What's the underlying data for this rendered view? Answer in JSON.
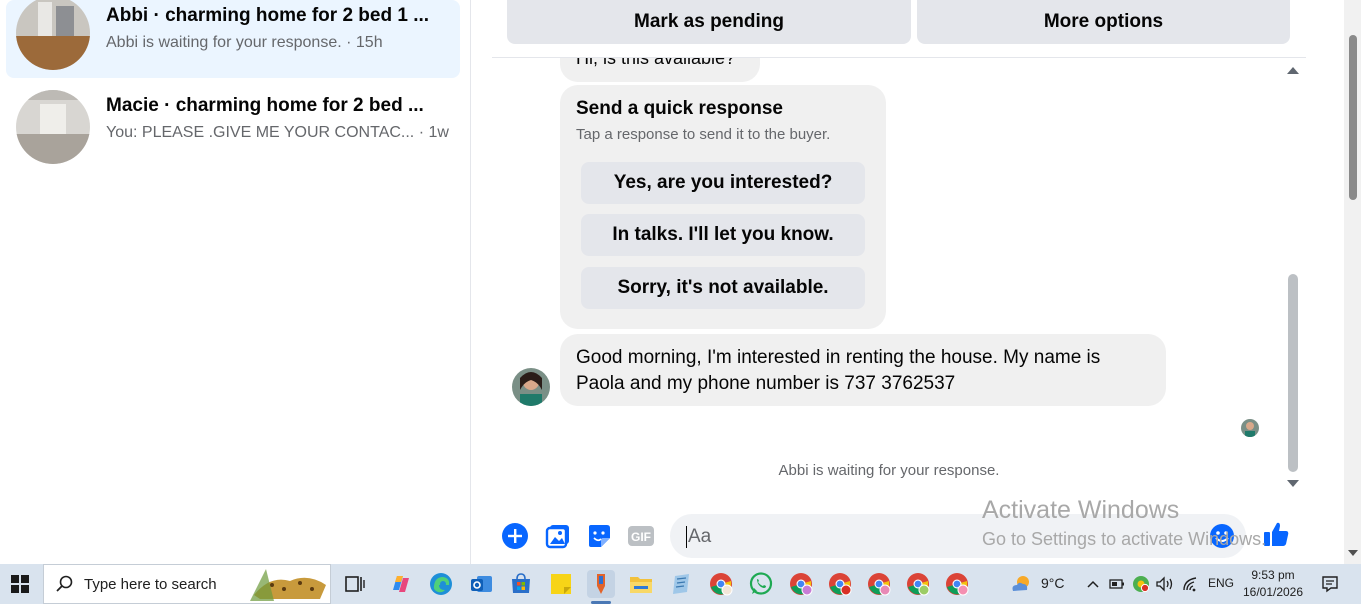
{
  "conversations": [
    {
      "title": "Abbi · charming home for 2 bed 1 ...",
      "snippet": "Abbi is waiting for your response. · 15h",
      "active": true
    },
    {
      "title": "Macie · charming home for 2 bed ...",
      "snippet": "You: PLEASE .GIVE ME YOUR CONTAC... · 1w",
      "active": false
    }
  ],
  "chat": {
    "buttons": {
      "pending": "Mark as pending",
      "more": "More options"
    },
    "prev_message": "Hi, is this available?",
    "quick_response": {
      "title": "Send a quick response",
      "subtitle": "Tap a response to send it to the buyer.",
      "options": [
        "Yes, are you interested?",
        "In talks. I'll let you know.",
        "Sorry, it's not available."
      ]
    },
    "message": "Good morning, I'm interested in renting the house. My name is Paola and my phone number is 737 3762537",
    "waiting_text": "Abbi is waiting for your response.",
    "composer": {
      "placeholder": "Aa"
    }
  },
  "watermark": {
    "line1": "Activate Windows",
    "line2": "Go to Settings to activate Windows."
  },
  "taskbar": {
    "search_placeholder": "Type here to search",
    "weather": "9°C",
    "language": "ENG",
    "time": "9:53 pm",
    "date": "16/01/2026"
  },
  "colors": {
    "accent": "#0866ff",
    "active_conv": "#ebf5ff",
    "bubble": "#f0f0f0",
    "taskbar": "#d9e3ee"
  }
}
